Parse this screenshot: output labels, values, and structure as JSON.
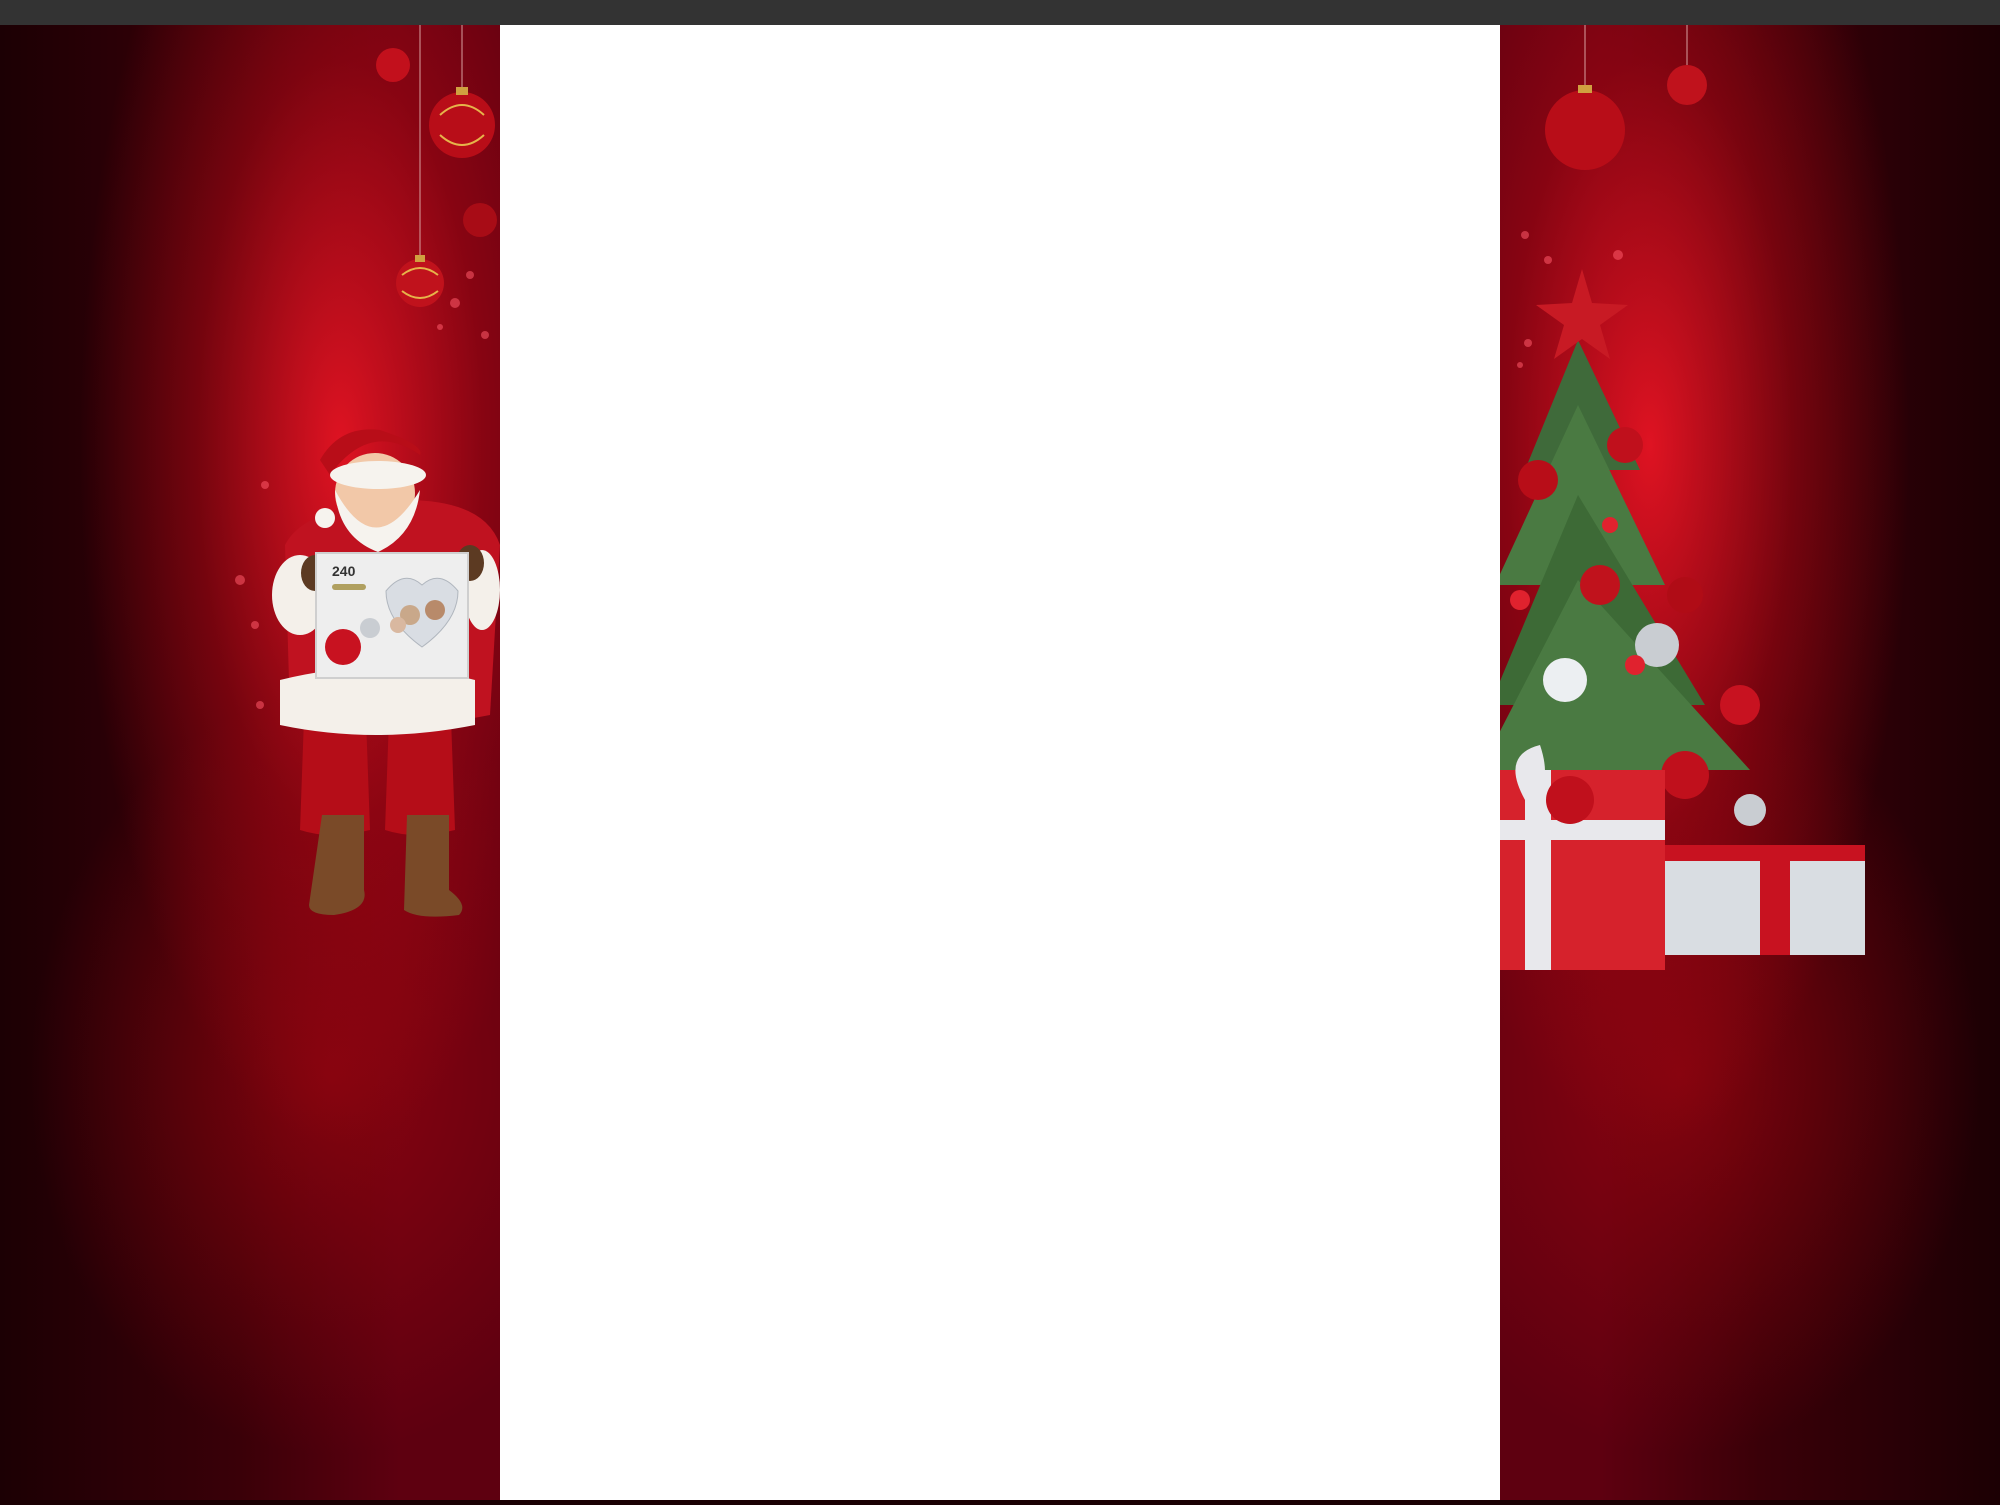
{
  "page": {
    "title": ""
  },
  "decor": {
    "left": {
      "figure": "santa-claus",
      "gift_box_label": "240",
      "ornaments": [
        "red-bauble",
        "red-bauble",
        "red-bauble",
        "red-bauble"
      ]
    },
    "right": {
      "figure": "christmas-tree",
      "gifts": [
        "red-gift-box",
        "silver-gift-box"
      ],
      "ornaments": [
        "red-bauble",
        "red-bauble"
      ]
    }
  },
  "colors": {
    "topbar": "#333333",
    "background_red": "#c0101e",
    "background_dark": "#1c0004",
    "content": "#ffffff"
  }
}
